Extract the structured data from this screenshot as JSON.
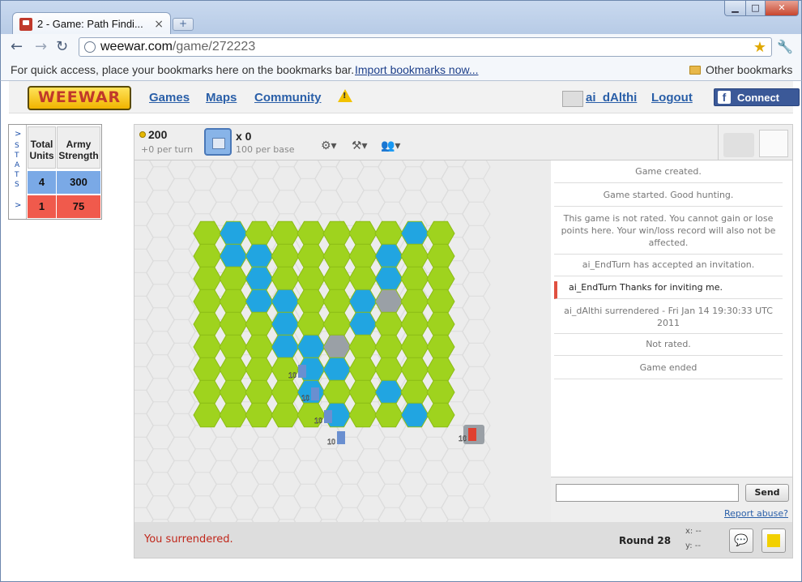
{
  "browser": {
    "tab_title": "2 - Game: Path Findi...",
    "tab_close": "×",
    "new_tab": "+",
    "url_host": "weewar.com",
    "url_path": "/game/272223",
    "bookmarks_text": "For quick access, place your bookmarks here on the bookmarks bar.",
    "bookmarks_import": "Import bookmarks now...",
    "other_bookmarks": "Other bookmarks",
    "win_min": "▁",
    "win_max": "□",
    "win_close": "✕"
  },
  "site": {
    "logo": "WEEWAR",
    "nav": {
      "games": "Games",
      "maps": "Maps",
      "community": "Community"
    },
    "warning_mark": "!",
    "username": "ai_dAlthi",
    "logout": "Logout",
    "fb_icon": "f",
    "fb_connect": "Connect"
  },
  "stats": {
    "arrow_top": ">",
    "label": "STATS",
    "arrow_bottom": ">",
    "headers": {
      "units": "Total Units",
      "army": "Army Strength"
    },
    "rows": [
      {
        "units": "4",
        "army": "300",
        "color": "#7aa9e6"
      },
      {
        "units": "1",
        "army": "75",
        "color": "#f05a4c"
      }
    ]
  },
  "game": {
    "gold": "200",
    "gold_rate": "+0 per turn",
    "bases": "x 0",
    "base_rate": "100 per base",
    "icons": {
      "settings": "⚙▾",
      "tools": "⚒▾",
      "players": "👥▾"
    },
    "colors": {
      "grass": "#9fd31e",
      "water": "#21a5e1",
      "bridge": "#9aa0a6",
      "empty": "#ececec"
    },
    "units": [
      {
        "label": "10",
        "color": "blue"
      },
      {
        "label": "10",
        "color": "blue"
      },
      {
        "label": "10",
        "color": "blue"
      },
      {
        "label": "10",
        "color": "blue"
      },
      {
        "label": "10",
        "color": "red"
      }
    ]
  },
  "chat": {
    "messages": [
      "Game created.",
      "Game started. Good hunting.",
      "This game is not rated. You cannot gain or lose points here. Your win/loss record will also not be affected.",
      "ai_EndTurn has accepted an invitation.",
      "ai_EndTurn  Thanks for inviting me.",
      "ai_dAlthi surrendered - Fri Jan 14 19:30:33 UTC 2011",
      "Not rated.",
      "Game ended"
    ],
    "send": "Send",
    "report": "Report abuse?"
  },
  "footer": {
    "status": "You surrendered.",
    "round": "Round 28",
    "x": "x: --",
    "y": "y: --",
    "chat_icon": "💬"
  }
}
